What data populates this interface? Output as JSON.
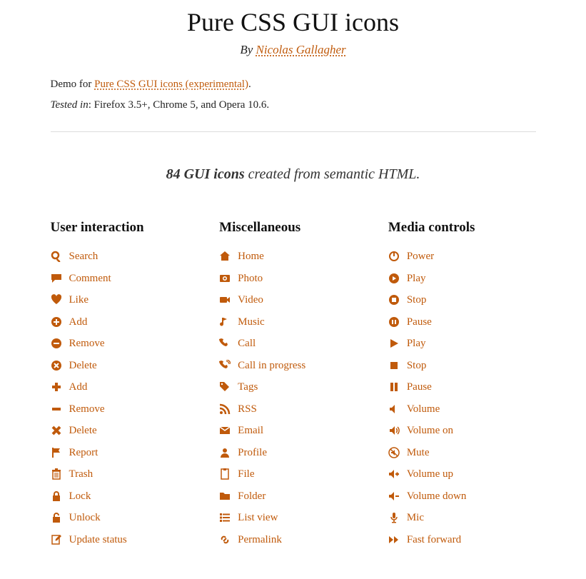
{
  "header": {
    "title": "Pure CSS GUI icons",
    "by_prefix": "By ",
    "author": "Nicolas Gallagher"
  },
  "intro": {
    "demo_prefix": "Demo for ",
    "demo_link": "Pure CSS GUI icons (experimental)",
    "demo_suffix": ".",
    "tested_label": "Tested in",
    "tested_text": ": Firefox 3.5+, Chrome 5, and Opera 10.6."
  },
  "summary": {
    "strong": "84 GUI icons",
    "rest": " created from semantic HTML."
  },
  "columns": [
    {
      "heading": "User interaction",
      "items": [
        {
          "icon": "search",
          "label": "Search"
        },
        {
          "icon": "comment",
          "label": "Comment"
        },
        {
          "icon": "heart",
          "label": "Like"
        },
        {
          "icon": "plus-circle",
          "label": "Add"
        },
        {
          "icon": "minus-circle",
          "label": "Remove"
        },
        {
          "icon": "x-circle",
          "label": "Delete"
        },
        {
          "icon": "plus",
          "label": "Add"
        },
        {
          "icon": "minus",
          "label": "Remove"
        },
        {
          "icon": "x",
          "label": "Delete"
        },
        {
          "icon": "flag",
          "label": "Report"
        },
        {
          "icon": "trash",
          "label": "Trash"
        },
        {
          "icon": "lock",
          "label": "Lock"
        },
        {
          "icon": "unlock",
          "label": "Unlock"
        },
        {
          "icon": "edit",
          "label": "Update status"
        }
      ]
    },
    {
      "heading": "Miscellaneous",
      "items": [
        {
          "icon": "home",
          "label": "Home"
        },
        {
          "icon": "photo",
          "label": "Photo"
        },
        {
          "icon": "video",
          "label": "Video"
        },
        {
          "icon": "music",
          "label": "Music"
        },
        {
          "icon": "call",
          "label": "Call"
        },
        {
          "icon": "call-progress",
          "label": "Call in progress"
        },
        {
          "icon": "tags",
          "label": "Tags"
        },
        {
          "icon": "rss",
          "label": "RSS"
        },
        {
          "icon": "email",
          "label": "Email"
        },
        {
          "icon": "profile",
          "label": "Profile"
        },
        {
          "icon": "file",
          "label": "File"
        },
        {
          "icon": "folder",
          "label": "Folder"
        },
        {
          "icon": "list",
          "label": "List view"
        },
        {
          "icon": "permalink",
          "label": "Permalink"
        }
      ]
    },
    {
      "heading": "Media controls",
      "items": [
        {
          "icon": "power",
          "label": "Power"
        },
        {
          "icon": "play-circle",
          "label": "Play"
        },
        {
          "icon": "stop-circle",
          "label": "Stop"
        },
        {
          "icon": "pause-circle",
          "label": "Pause"
        },
        {
          "icon": "play",
          "label": "Play"
        },
        {
          "icon": "stop",
          "label": "Stop"
        },
        {
          "icon": "pause",
          "label": "Pause"
        },
        {
          "icon": "volume",
          "label": "Volume"
        },
        {
          "icon": "volume-on",
          "label": "Volume on"
        },
        {
          "icon": "mute",
          "label": "Mute"
        },
        {
          "icon": "volume-up",
          "label": "Volume up"
        },
        {
          "icon": "volume-down",
          "label": "Volume down"
        },
        {
          "icon": "mic",
          "label": "Mic"
        },
        {
          "icon": "fast-forward",
          "label": "Fast forward"
        }
      ]
    }
  ]
}
